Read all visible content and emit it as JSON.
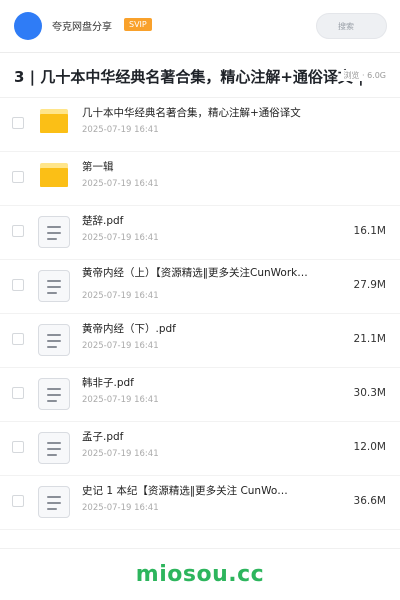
{
  "header": {
    "account_name": "夸克网盘分享",
    "badge": "SVIP",
    "search_placeholder": "搜索"
  },
  "folder": {
    "title": "3 | 几十本中华经典名著合集，精心注解+通俗译文 |",
    "meta_views": "浏览",
    "meta_size": "6.0G"
  },
  "files": [
    {
      "type": "folder",
      "name": "几十本中华经典名著合集，精心注解+通俗译文",
      "date": "2025-07-19 16:41",
      "size": ""
    },
    {
      "type": "folder",
      "name": "第一辑",
      "date": "2025-07-19 16:41",
      "size": ""
    },
    {
      "type": "file",
      "name": "楚辞.pdf",
      "date": "2025-07-19 16:41",
      "size": "16.1M"
    },
    {
      "type": "file",
      "name": "黄帝内经（上）【资源精选‖更多关注CunWork…",
      "date": "2025-07-19 16:41",
      "size": "27.9M"
    },
    {
      "type": "file",
      "name": "黄帝内经（下）.pdf",
      "date": "2025-07-19 16:41",
      "size": "21.1M"
    },
    {
      "type": "file",
      "name": "韩非子.pdf",
      "date": "2025-07-19 16:41",
      "size": "30.3M"
    },
    {
      "type": "file",
      "name": "孟子.pdf",
      "date": "2025-07-19 16:41",
      "size": "12.0M"
    },
    {
      "type": "file",
      "name": "史记 1 本纪【资源精选‖更多关注 CunWo…",
      "date": "2025-07-19 16:41",
      "size": "36.6M"
    }
  ],
  "watermark": "miosou.cc"
}
